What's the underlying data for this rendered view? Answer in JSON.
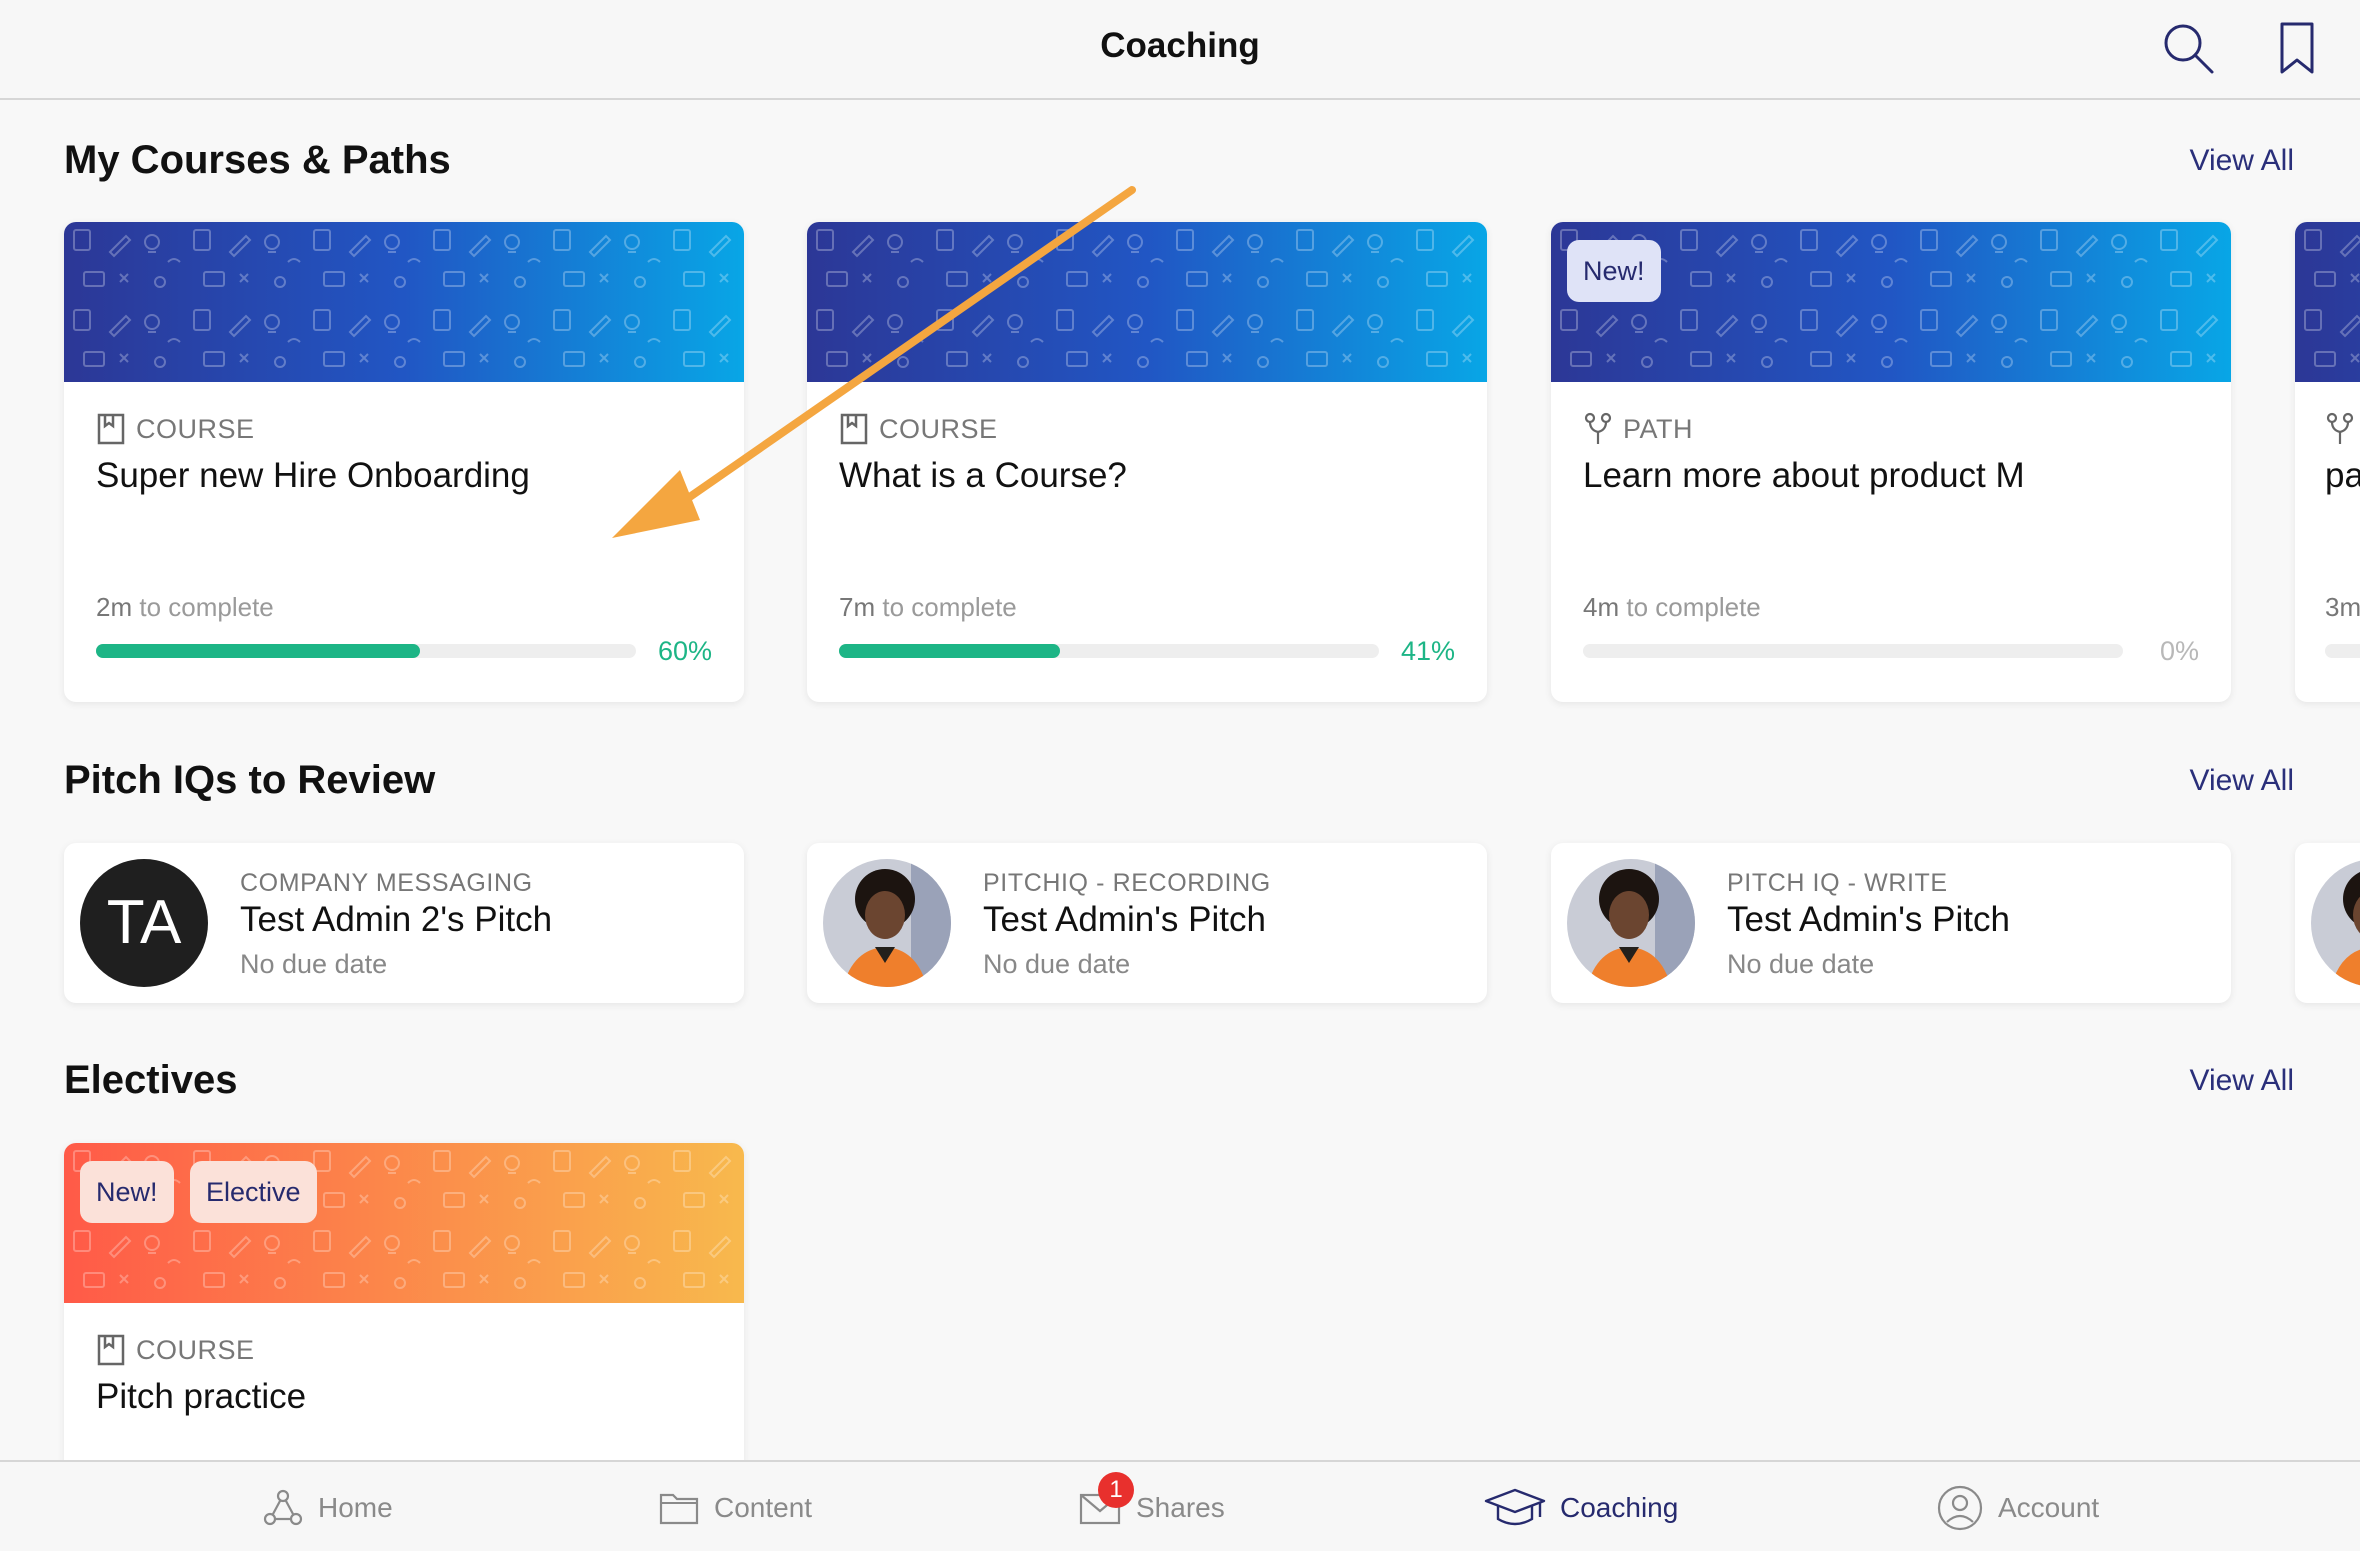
{
  "header": {
    "title": "Coaching",
    "search_icon": "search-icon",
    "bookmark_icon": "bookmark-icon"
  },
  "sections": {
    "courses": {
      "title": "My Courses & Paths",
      "view_all": "View All"
    },
    "pitch": {
      "title": "Pitch IQs to Review",
      "view_all": "View All"
    },
    "electives": {
      "title": "Electives",
      "view_all": "View All"
    }
  },
  "courses": [
    {
      "type": "COURSE",
      "name": "Super new Hire Onboarding",
      "time": "2m",
      "time_suffix": " to complete",
      "progress": 60,
      "progress_label": "60%",
      "badge": ""
    },
    {
      "type": "COURSE",
      "name": "What is a Course?",
      "time": "7m",
      "time_suffix": " to complete",
      "progress": 41,
      "progress_label": "41%",
      "badge": ""
    },
    {
      "type": "PATH",
      "name": "Learn more about product M",
      "time": "4m",
      "time_suffix": " to complete",
      "progress": 0,
      "progress_label": "0%",
      "badge": "New!"
    },
    {
      "type": "",
      "name": "pa",
      "time": "3m",
      "time_suffix": "",
      "progress": 0,
      "progress_label": "",
      "badge": ""
    }
  ],
  "pitches": [
    {
      "type": "COMPANY MESSAGING",
      "name": "Test Admin 2's Pitch",
      "due": "No due date",
      "initials": "TA"
    },
    {
      "type": "PITCHIQ - RECORDING",
      "name": "Test Admin's Pitch",
      "due": "No due date",
      "initials": ""
    },
    {
      "type": "PITCH IQ - WRITE",
      "name": "Test Admin's Pitch",
      "due": "No due date",
      "initials": ""
    }
  ],
  "electives": [
    {
      "type": "COURSE",
      "name": "Pitch practice",
      "badges": [
        "New!",
        "Elective"
      ]
    }
  ],
  "tabs": [
    {
      "label": "Home",
      "icon": "home-network-icon"
    },
    {
      "label": "Content",
      "icon": "folder-icon"
    },
    {
      "label": "Shares",
      "icon": "envelope-icon",
      "notification": "1"
    },
    {
      "label": "Coaching",
      "icon": "graduation-cap-icon",
      "active": true
    },
    {
      "label": "Account",
      "icon": "user-circle-icon"
    }
  ],
  "colors": {
    "accent": "#262a6e",
    "progress_green": "#1db586",
    "banner_blue_start": "#2c3a9c",
    "banner_blue_end": "#08a6e6",
    "banner_orange_start": "#ff5b49",
    "banner_orange_end": "#f9b34a",
    "annotation_arrow": "#f4a640",
    "notification_red": "#e8302d"
  }
}
